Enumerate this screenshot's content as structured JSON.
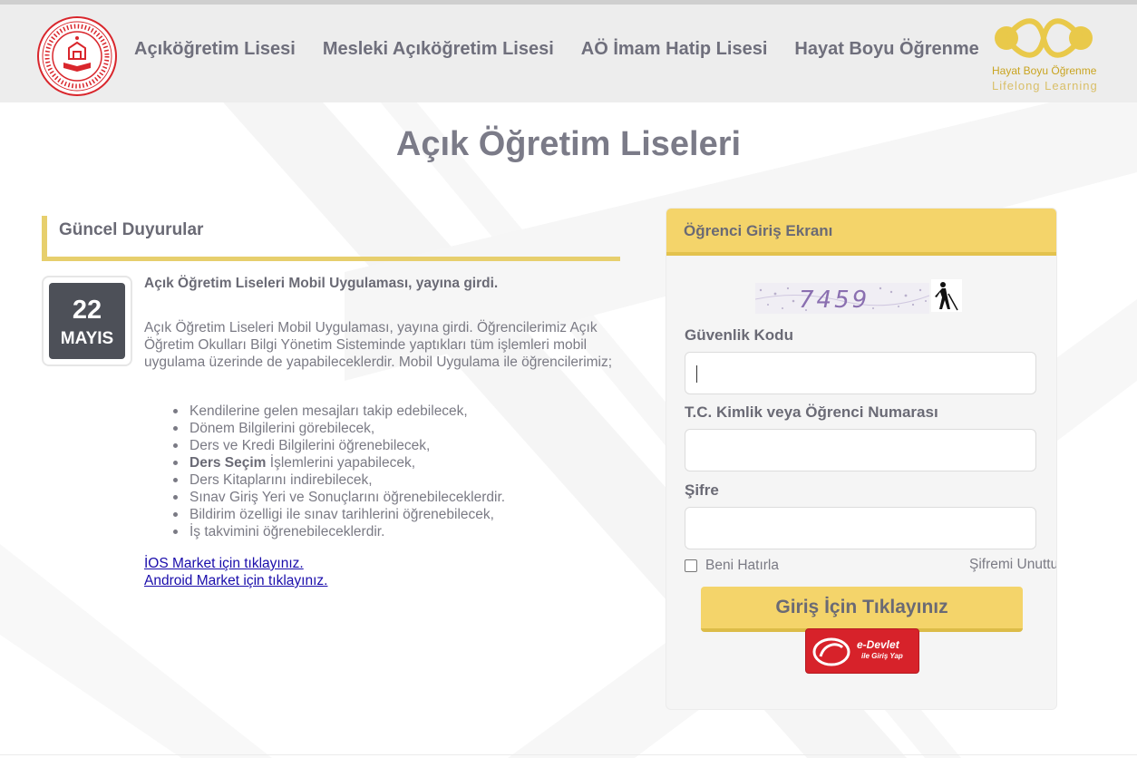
{
  "header": {
    "nav": [
      {
        "label": "Açıköğretim Lisesi"
      },
      {
        "label": "Mesleki Açıköğretim Lisesi"
      },
      {
        "label": "AÖ İmam Hatip Lisesi"
      },
      {
        "label": "Hayat Boyu Öğrenme"
      }
    ],
    "hbo_logo": {
      "line1": "Hayat Boyu Öğrenme",
      "line2": "Lifelong Learning"
    },
    "meb_logo_icon": "ministry-seal-icon"
  },
  "page": {
    "title": "Açık Öğretim Liseleri"
  },
  "news": {
    "heading": "Güncel Duyurular",
    "item": {
      "day": "22",
      "month": "MAYIS",
      "title": "Açık Öğretim Liseleri Mobil Uygulaması, yayına girdi.",
      "paragraph": "Açık Öğretim Liseleri Mobil Uygulaması, yayına girdi. Öğrencilerimiz Açık Öğretim Okulları Bilgi Yönetim Sisteminde yaptıkları tüm işlemleri mobil uygulama üzerinde de yapabileceklerdir. Mobil Uygulama ile öğrencilerimiz;",
      "list": [
        {
          "text": "Kendilerine gelen mesajları takip edebilecek,"
        },
        {
          "text": "Dönem Bilgilerini görebilecek,"
        },
        {
          "text": "Ders ve Kredi Bilgilerini öğrenebilecek,"
        },
        {
          "bold": "Ders Seçim",
          "text": " İşlemlerini yapabilecek,"
        },
        {
          "text": "Ders Kitaplarını indirebilecek,"
        },
        {
          "text": "Sınav Giriş Yeri ve Sonuçlarını öğrenebileceklerdir."
        },
        {
          "text": "Bildirim özelligi ile sınav tarihlerini öğrenebilecek,"
        },
        {
          "text": "İş takvimini öğrenebileceklerdir."
        }
      ],
      "links": {
        "ios": "İOS Market için tıklayınız.",
        "android": "Android Market için tıklayınız."
      }
    }
  },
  "login": {
    "heading": "Öğrenci Giriş Ekranı",
    "captcha_text": "7459",
    "accessibility_icon": "blind-person-icon",
    "security_code_label": "Güvenlik Kodu",
    "security_code_value": "",
    "id_label": "T.C. Kimlik veya Öğrenci Numarası",
    "id_value": "",
    "password_label": "Şifre",
    "password_value": "",
    "remember_label": "Beni Hatırla",
    "remember_checked": false,
    "forgot_label": "Şifremi Unuttum",
    "submit_label": "Giriş İçin Tıklayınız",
    "edevlet": {
      "line1": "e-Devlet",
      "line2": "ile Giriş Yap"
    }
  },
  "colors": {
    "accent": "#f4d46a",
    "accent_dark": "#e3c24d",
    "text": "#6a6a75",
    "edevlet_red": "#d7222a",
    "link": "#1a0dab"
  }
}
